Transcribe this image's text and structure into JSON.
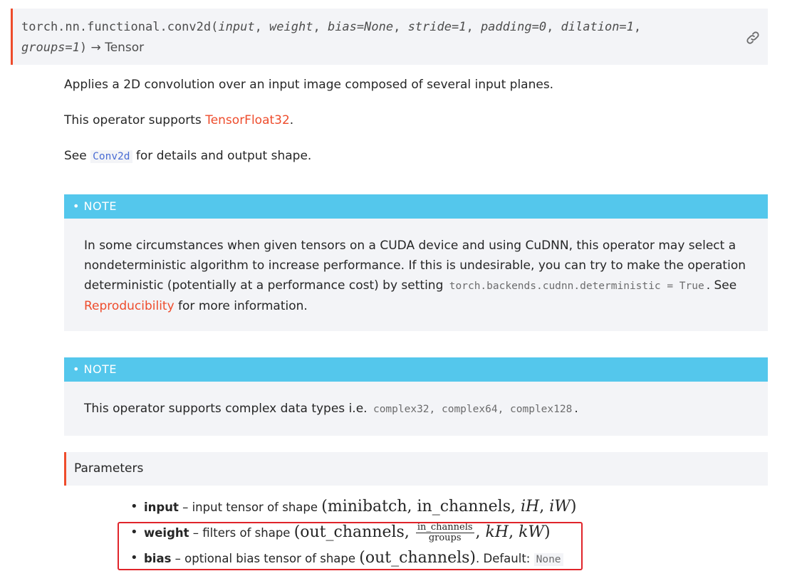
{
  "signature": {
    "module": "torch.nn.functional.",
    "func": "conv2d",
    "open": "(",
    "args": [
      "input",
      "weight",
      "bias=None",
      "stride=1",
      "padding=0",
      "dilation=1",
      "groups=1"
    ],
    "close": ")",
    "returns": " → Tensor",
    "link_icon": "link-icon"
  },
  "description": "Applies a 2D convolution over an input image composed of several input planes.",
  "tf32": {
    "prefix": "This operator supports ",
    "link": "TensorFloat32",
    "suffix": "."
  },
  "see": {
    "prefix": "See ",
    "code": "Conv2d",
    "suffix": " for details and output shape."
  },
  "note1": {
    "label": "NOTE",
    "line1": "In some circumstances when given tensors on a CUDA device and using CuDNN, this operator may select a",
    "line2": "nondeterministic algorithm to increase performance. If this is undesirable, you can try to make the operation",
    "line3_prefix": "deterministic (potentially at a performance cost) by setting ",
    "code": "torch.backends.cudnn.deterministic = True",
    "line3_suffix": ". See",
    "link": "Reproducibility",
    "line4_suffix": " for more information."
  },
  "note2": {
    "label": "NOTE",
    "prefix": "This operator supports complex data types i.e. ",
    "code": "complex32, complex64, complex128",
    "suffix": "."
  },
  "parameters_label": "Parameters",
  "params": [
    {
      "name": "input",
      "desc": " – input tensor of shape ",
      "math_parts": [
        "(minibatch, in_channels, ",
        "iH",
        ", ",
        "iW",
        ")"
      ]
    },
    {
      "name": "weight",
      "desc": " – filters of shape ",
      "frac_num": "in_channels",
      "frac_den": "groups",
      "math_pre": "(out_channels, ",
      "math_post_1": ", ",
      "kH": "kH",
      "math_post_2": ", ",
      "kW": "kW",
      "math_close": ")"
    },
    {
      "name": "bias",
      "desc": " – optional bias tensor of shape ",
      "math": "(out_channels)",
      "default_label": ". Default: ",
      "default": "None"
    }
  ]
}
